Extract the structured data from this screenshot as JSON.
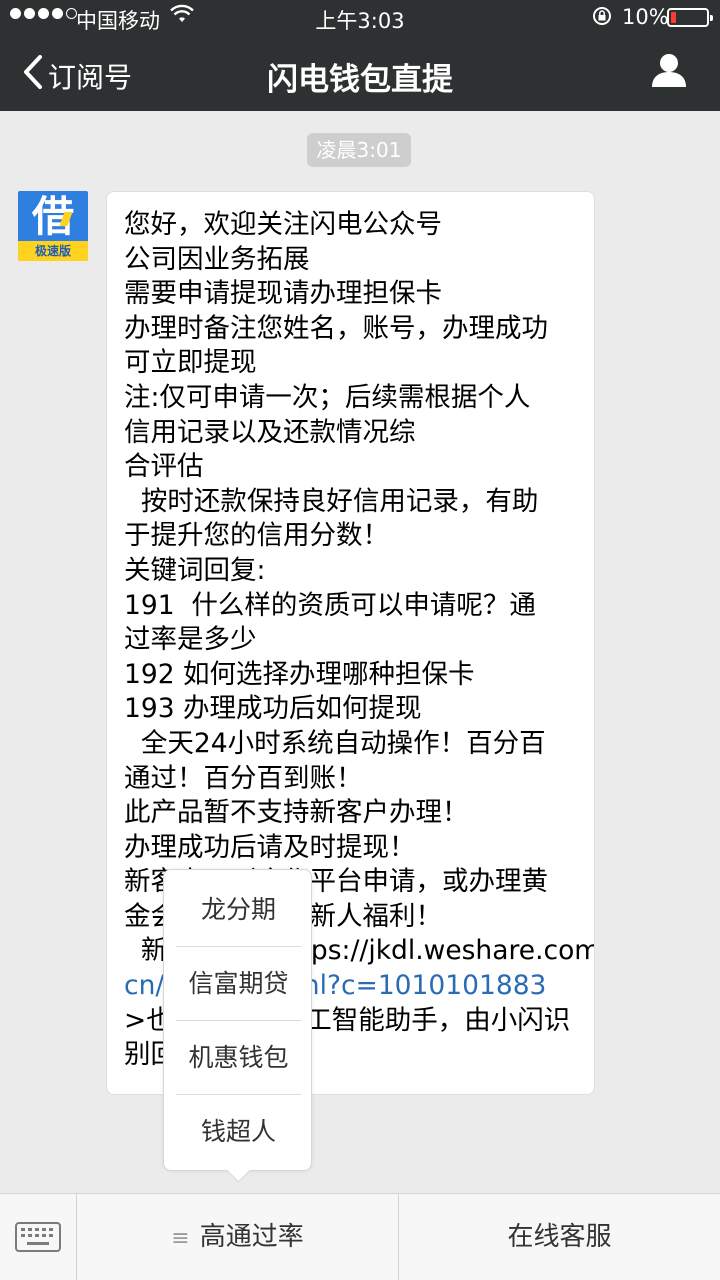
{
  "status_bar": {
    "carrier": "中国移动",
    "time": "上午3:03",
    "battery_percent": "10%",
    "signal_bars": 4,
    "signal_total": 5
  },
  "nav": {
    "back_label": "订阅号",
    "title": "闪电钱包直提",
    "icons": {
      "back": "chevron-left-icon",
      "profile": "person-icon"
    }
  },
  "chat": {
    "timestamp": "凌晨3:01",
    "avatar": {
      "glyph": "借",
      "band_text": "极速版",
      "colors": {
        "bg": "#2f7fe0",
        "band": "#ffd21f"
      }
    },
    "message_lines": [
      "您好，欢迎关注闪电公众号",
      "公司因业务拓展",
      "需要申请提现请办理担保卡",
      "办理时备注您姓名，账号，办理成功",
      "可立即提现",
      "注:仅可申请一次；后续需根据个人",
      "信用记录以及还款情况综",
      "合评估",
      "  按时还款保持良好信用记录，有助",
      "于提升您的信用分数！",
      "关键词回复:",
      "191  什么样的资质可以申请呢？通",
      "过率是多少",
      "192 如何选择办理哪种担保卡",
      "193 办理成功后如何提现",
      "  全天24小时系统自动操作！百分百",
      "通过！百分百到账！",
      "此产品暂不支持新客户办理！",
      "办理成功后请及时提现！",
      "新客户可到合作平台申请，或办理黄",
      "金会员享受更多新人福利！",
      "  新客户申请https://jkdl.weshare.com.",
      "cn/activity.html?c=1010101883",
      ">也可以咨询人工智能助手，由小闪识",
      "别回复"
    ],
    "link_colour": "#2a6bb4"
  },
  "popup_menu": {
    "items": [
      "龙分期",
      "信富期贷",
      "机惠钱包",
      "钱超人"
    ]
  },
  "bottom_bar": {
    "keyboard_icon": "keyboard-icon",
    "menu_icon": "menu-lines-icon",
    "button1": "高通过率",
    "button2": "在线客服"
  }
}
